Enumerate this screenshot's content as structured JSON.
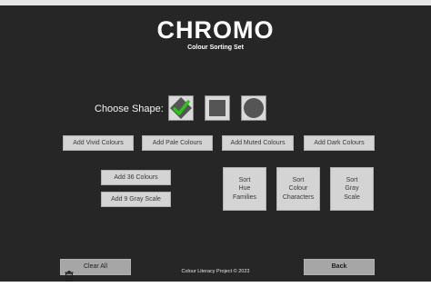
{
  "header": {
    "title": "CHROMO",
    "subtitle": "Colour Sorting Set"
  },
  "shape_picker": {
    "label": "Choose Shape:",
    "options": [
      {
        "name": "diamond",
        "icon": "diamond-check-icon",
        "selected": true
      },
      {
        "name": "square",
        "icon": "square-icon",
        "selected": false
      },
      {
        "name": "circle",
        "icon": "circle-icon",
        "selected": false
      }
    ]
  },
  "colour_buttons": [
    "Add Vivid Colours",
    "Add Pale Colours",
    "Add Muted Colours",
    "Add Dark Colours"
  ],
  "add_buttons": [
    "Add 36 Colours",
    "Add 9 Gray Scale"
  ],
  "sort_buttons": [
    "Sort\nHue\nFamilies",
    "Sort\nColour\nCharacters",
    "Sort\nGray\nScale"
  ],
  "actions": {
    "clear_all": "Clear All",
    "back": "Back"
  },
  "footer": {
    "credit": "Colour Literacy Project © 2023"
  },
  "colors": {
    "background": "#262626",
    "button": "#d4d4d4",
    "check": "#2ec21a"
  }
}
